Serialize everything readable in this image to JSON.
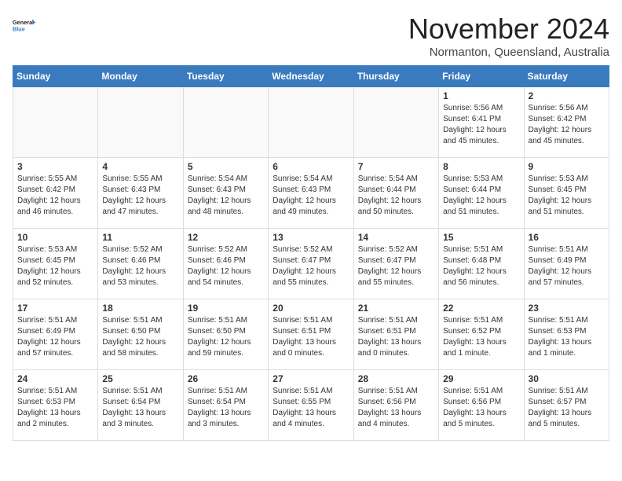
{
  "header": {
    "logo_line1": "General",
    "logo_line2": "Blue",
    "month_title": "November 2024",
    "location": "Normanton, Queensland, Australia"
  },
  "weekdays": [
    "Sunday",
    "Monday",
    "Tuesday",
    "Wednesday",
    "Thursday",
    "Friday",
    "Saturday"
  ],
  "weeks": [
    [
      {
        "day": "",
        "info": ""
      },
      {
        "day": "",
        "info": ""
      },
      {
        "day": "",
        "info": ""
      },
      {
        "day": "",
        "info": ""
      },
      {
        "day": "",
        "info": ""
      },
      {
        "day": "1",
        "info": "Sunrise: 5:56 AM\nSunset: 6:41 PM\nDaylight: 12 hours\nand 45 minutes."
      },
      {
        "day": "2",
        "info": "Sunrise: 5:56 AM\nSunset: 6:42 PM\nDaylight: 12 hours\nand 45 minutes."
      }
    ],
    [
      {
        "day": "3",
        "info": "Sunrise: 5:55 AM\nSunset: 6:42 PM\nDaylight: 12 hours\nand 46 minutes."
      },
      {
        "day": "4",
        "info": "Sunrise: 5:55 AM\nSunset: 6:43 PM\nDaylight: 12 hours\nand 47 minutes."
      },
      {
        "day": "5",
        "info": "Sunrise: 5:54 AM\nSunset: 6:43 PM\nDaylight: 12 hours\nand 48 minutes."
      },
      {
        "day": "6",
        "info": "Sunrise: 5:54 AM\nSunset: 6:43 PM\nDaylight: 12 hours\nand 49 minutes."
      },
      {
        "day": "7",
        "info": "Sunrise: 5:54 AM\nSunset: 6:44 PM\nDaylight: 12 hours\nand 50 minutes."
      },
      {
        "day": "8",
        "info": "Sunrise: 5:53 AM\nSunset: 6:44 PM\nDaylight: 12 hours\nand 51 minutes."
      },
      {
        "day": "9",
        "info": "Sunrise: 5:53 AM\nSunset: 6:45 PM\nDaylight: 12 hours\nand 51 minutes."
      }
    ],
    [
      {
        "day": "10",
        "info": "Sunrise: 5:53 AM\nSunset: 6:45 PM\nDaylight: 12 hours\nand 52 minutes."
      },
      {
        "day": "11",
        "info": "Sunrise: 5:52 AM\nSunset: 6:46 PM\nDaylight: 12 hours\nand 53 minutes."
      },
      {
        "day": "12",
        "info": "Sunrise: 5:52 AM\nSunset: 6:46 PM\nDaylight: 12 hours\nand 54 minutes."
      },
      {
        "day": "13",
        "info": "Sunrise: 5:52 AM\nSunset: 6:47 PM\nDaylight: 12 hours\nand 55 minutes."
      },
      {
        "day": "14",
        "info": "Sunrise: 5:52 AM\nSunset: 6:47 PM\nDaylight: 12 hours\nand 55 minutes."
      },
      {
        "day": "15",
        "info": "Sunrise: 5:51 AM\nSunset: 6:48 PM\nDaylight: 12 hours\nand 56 minutes."
      },
      {
        "day": "16",
        "info": "Sunrise: 5:51 AM\nSunset: 6:49 PM\nDaylight: 12 hours\nand 57 minutes."
      }
    ],
    [
      {
        "day": "17",
        "info": "Sunrise: 5:51 AM\nSunset: 6:49 PM\nDaylight: 12 hours\nand 57 minutes."
      },
      {
        "day": "18",
        "info": "Sunrise: 5:51 AM\nSunset: 6:50 PM\nDaylight: 12 hours\nand 58 minutes."
      },
      {
        "day": "19",
        "info": "Sunrise: 5:51 AM\nSunset: 6:50 PM\nDaylight: 12 hours\nand 59 minutes."
      },
      {
        "day": "20",
        "info": "Sunrise: 5:51 AM\nSunset: 6:51 PM\nDaylight: 13 hours\nand 0 minutes."
      },
      {
        "day": "21",
        "info": "Sunrise: 5:51 AM\nSunset: 6:51 PM\nDaylight: 13 hours\nand 0 minutes."
      },
      {
        "day": "22",
        "info": "Sunrise: 5:51 AM\nSunset: 6:52 PM\nDaylight: 13 hours\nand 1 minute."
      },
      {
        "day": "23",
        "info": "Sunrise: 5:51 AM\nSunset: 6:53 PM\nDaylight: 13 hours\nand 1 minute."
      }
    ],
    [
      {
        "day": "24",
        "info": "Sunrise: 5:51 AM\nSunset: 6:53 PM\nDaylight: 13 hours\nand 2 minutes."
      },
      {
        "day": "25",
        "info": "Sunrise: 5:51 AM\nSunset: 6:54 PM\nDaylight: 13 hours\nand 3 minutes."
      },
      {
        "day": "26",
        "info": "Sunrise: 5:51 AM\nSunset: 6:54 PM\nDaylight: 13 hours\nand 3 minutes."
      },
      {
        "day": "27",
        "info": "Sunrise: 5:51 AM\nSunset: 6:55 PM\nDaylight: 13 hours\nand 4 minutes."
      },
      {
        "day": "28",
        "info": "Sunrise: 5:51 AM\nSunset: 6:56 PM\nDaylight: 13 hours\nand 4 minutes."
      },
      {
        "day": "29",
        "info": "Sunrise: 5:51 AM\nSunset: 6:56 PM\nDaylight: 13 hours\nand 5 minutes."
      },
      {
        "day": "30",
        "info": "Sunrise: 5:51 AM\nSunset: 6:57 PM\nDaylight: 13 hours\nand 5 minutes."
      }
    ]
  ]
}
